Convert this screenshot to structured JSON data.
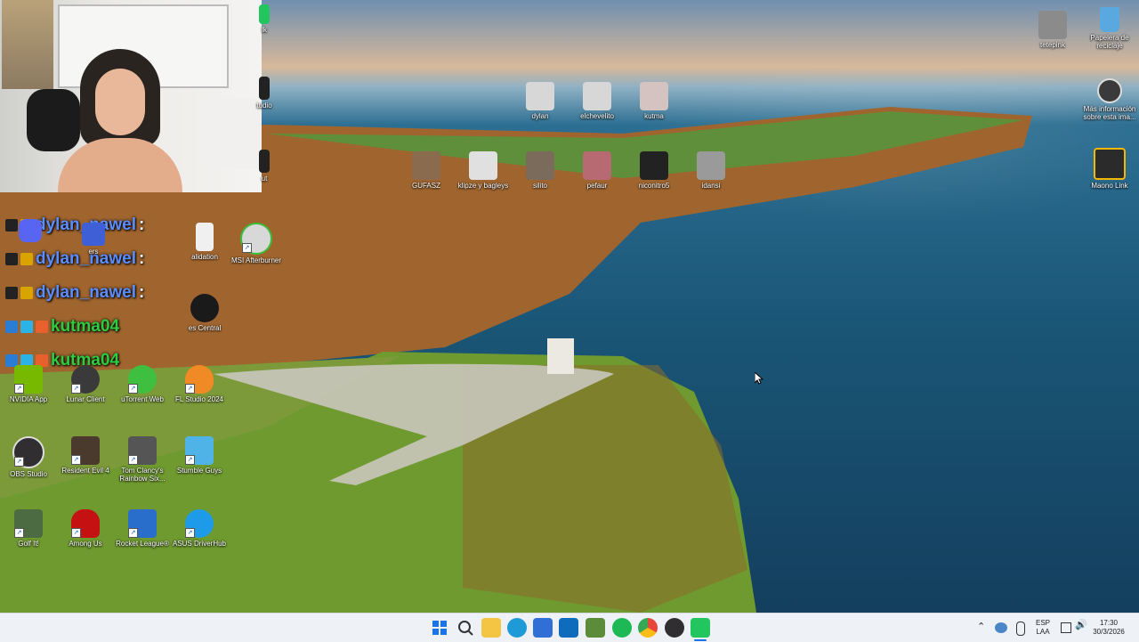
{
  "desktop": {
    "icons": [
      {
        "id": "dylan",
        "label": "dylan",
        "color": "#d7d7d7",
        "icon": "cat-photo-icon"
      },
      {
        "id": "elchevelito",
        "label": "elchevelito",
        "color": "#d7d7d7",
        "icon": "cat-photo-icon"
      },
      {
        "id": "kutma",
        "label": "kutma",
        "color": "#d4c3c0",
        "icon": "cat-photo-icon"
      },
      {
        "id": "gufasz",
        "label": "GUFASZ",
        "color": "#8b6b4e",
        "icon": "folder-photo-icon"
      },
      {
        "id": "klipze",
        "label": "klipze y bagleys",
        "color": "#e0e0e0",
        "icon": "folder-photo-icon"
      },
      {
        "id": "silito",
        "label": "silito",
        "color": "#7a6b5a",
        "icon": "folder-photo-icon"
      },
      {
        "id": "pefaur",
        "label": "pefaur",
        "color": "#b86a72",
        "icon": "folder-photo-icon"
      },
      {
        "id": "niconitro",
        "label": "niconitro5",
        "color": "#222222",
        "icon": "folder-photo-icon"
      },
      {
        "id": "idansi",
        "label": "idansi",
        "color": "#9a9a9a",
        "icon": "folder-photo-icon"
      },
      {
        "id": "tetepink",
        "label": "tetepink",
        "color": "#8b8b8b",
        "icon": "cat-photo-icon"
      },
      {
        "id": "recycle",
        "label": "Papelera de reciclaje",
        "color": "#5aa8e0",
        "icon": "recycle-bin-icon"
      },
      {
        "id": "spotlight",
        "label": "Más información sobre esta ima...",
        "color": "#3a3a3a",
        "icon": "camera-icon"
      },
      {
        "id": "maono",
        "label": "Maono Link",
        "color": "#2b2b2b",
        "icon": "maono-link-icon"
      },
      {
        "id": "nvidia",
        "label": "NVIDIA App",
        "color": "#76b900",
        "icon": "nvidia-icon"
      },
      {
        "id": "lunar",
        "label": "Lunar Client",
        "color": "#3a3a3a",
        "icon": "lunar-client-icon"
      },
      {
        "id": "utorrent",
        "label": "uTorrent Web",
        "color": "#3fbf3f",
        "icon": "utorrent-icon"
      },
      {
        "id": "flstudio",
        "label": "FL Studio 2024",
        "color": "#f08a24",
        "icon": "fl-studio-icon"
      },
      {
        "id": "obs",
        "label": "OBS Studio",
        "color": "#302e31",
        "icon": "obs-icon"
      },
      {
        "id": "re4",
        "label": "Resident Evil 4",
        "color": "#4a3a2e",
        "icon": "resident-evil-icon"
      },
      {
        "id": "r6",
        "label": "Tom Clancy's Rainbow Six...",
        "color": "#555555",
        "icon": "rainbow-six-icon"
      },
      {
        "id": "stumble",
        "label": "Stumble Guys",
        "color": "#4fb3e8",
        "icon": "stumble-guys-icon"
      },
      {
        "id": "golf",
        "label": "Golf It!",
        "color": "#4c6b43",
        "icon": "golf-it-icon"
      },
      {
        "id": "amongus",
        "label": "Among Us",
        "color": "#c51111",
        "icon": "among-us-icon"
      },
      {
        "id": "rocket",
        "label": "Rocket League®",
        "color": "#2a6ecb",
        "icon": "rocket-league-icon"
      },
      {
        "id": "asus",
        "label": "ASUS DriverHub",
        "color": "#1e9be8",
        "icon": "asus-driverhub-icon"
      },
      {
        "id": "msi",
        "label": "MSI Afterburner",
        "color": "#d8d8d8",
        "icon": "msi-afterburner-icon"
      },
      {
        "id": "validation",
        "label": "alidation",
        "color": "#f0f0f0",
        "icon": "document-icon"
      },
      {
        "id": "central",
        "label": "es Central",
        "color": "#1a1a1a",
        "icon": "waves-central-icon"
      },
      {
        "id": "players",
        "label": "ers",
        "color": "#3f5fd6",
        "icon": "players-icon"
      },
      {
        "id": "discord",
        "label": "",
        "color": "#5865f2",
        "icon": "discord-icon"
      },
      {
        "id": "talk",
        "label": "lk",
        "color": "#22c55e",
        "icon": "app-icon"
      },
      {
        "id": "studio",
        "label": "tudio",
        "color": "#222222",
        "icon": "app-icon"
      },
      {
        "id": "cut",
        "label": "ut",
        "color": "#222222",
        "icon": "capcut-icon"
      }
    ]
  },
  "chat": {
    "lines": [
      {
        "user": "dylan_nawel",
        "suffix": " :",
        "color": "#5b8dff"
      },
      {
        "user": "dylan_nawel",
        "suffix": " :",
        "color": "#5b8dff"
      },
      {
        "user": "dylan_nawel",
        "suffix": " :",
        "color": "#5b8dff"
      },
      {
        "user": "kutma04",
        "suffix": "",
        "color": "#2ecc40"
      },
      {
        "user": "kutma04",
        "suffix": "",
        "color": "#2ecc40"
      }
    ]
  },
  "taskbar": {
    "apps": [
      {
        "name": "start",
        "color": "#1a73e8",
        "icon": "windows-icon"
      },
      {
        "name": "search",
        "color": "#333333",
        "icon": "search-icon"
      },
      {
        "name": "file-explorer",
        "color": "#f4c542",
        "icon": "folder-icon"
      },
      {
        "name": "edge",
        "color": "#1e9ad6",
        "icon": "edge-icon"
      },
      {
        "name": "store",
        "color": "#2f6fd6",
        "icon": "store-icon"
      },
      {
        "name": "outlook",
        "color": "#0f6cbd",
        "icon": "outlook-icon"
      },
      {
        "name": "minecraft",
        "color": "#5b8c3a",
        "icon": "minecraft-icon"
      },
      {
        "name": "spotify",
        "color": "#1db954",
        "icon": "spotify-icon"
      },
      {
        "name": "chrome",
        "color": "#e8453c",
        "icon": "chrome-icon"
      },
      {
        "name": "obs",
        "color": "#302e31",
        "icon": "obs-icon"
      },
      {
        "name": "app",
        "color": "#22c55e",
        "icon": "app-icon"
      }
    ],
    "tray": {
      "lang_top": "ESP",
      "lang_bottom": "LAA",
      "time": "17:30",
      "date": "30/3/2026"
    }
  }
}
